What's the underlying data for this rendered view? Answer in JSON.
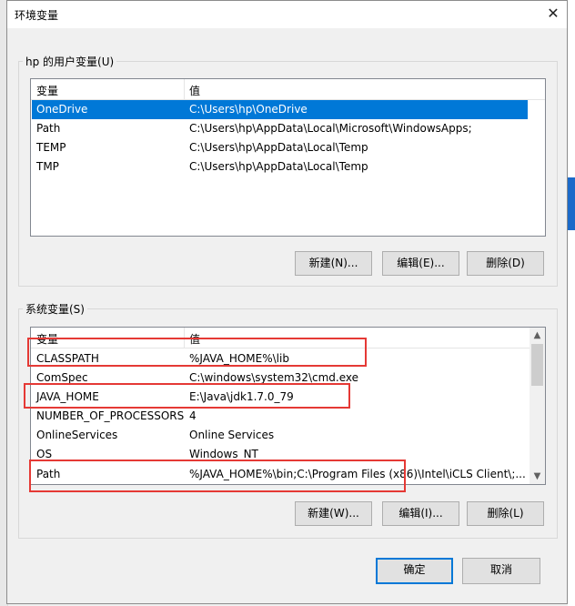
{
  "window": {
    "title": "环境变量",
    "close_glyph": "✕"
  },
  "user_vars": {
    "group_label": "hp 的用户变量(U)",
    "columns": [
      "变量",
      "值"
    ],
    "rows": [
      {
        "name": "OneDrive",
        "value": "C:\\Users\\hp\\OneDrive"
      },
      {
        "name": "Path",
        "value": "C:\\Users\\hp\\AppData\\Local\\Microsoft\\WindowsApps;"
      },
      {
        "name": "TEMP",
        "value": "C:\\Users\\hp\\AppData\\Local\\Temp"
      },
      {
        "name": "TMP",
        "value": "C:\\Users\\hp\\AppData\\Local\\Temp"
      }
    ],
    "buttons": {
      "new": "新建(N)...",
      "edit": "编辑(E)...",
      "delete": "删除(D)"
    }
  },
  "system_vars": {
    "group_label": "系统变量(S)",
    "columns": [
      "变量",
      "值"
    ],
    "rows": [
      {
        "name": "CLASSPATH",
        "value": "%JAVA_HOME%\\lib"
      },
      {
        "name": "ComSpec",
        "value": "C:\\windows\\system32\\cmd.exe"
      },
      {
        "name": "JAVA_HOME",
        "value": "E:\\Java\\jdk1.7.0_79"
      },
      {
        "name": "NUMBER_OF_PROCESSORS",
        "value": "4"
      },
      {
        "name": "OnlineServices",
        "value": "Online Services"
      },
      {
        "name": "OS",
        "value": "Windows_NT"
      },
      {
        "name": "Path",
        "value": "%JAVA_HOME%\\bin;C:\\Program Files (x86)\\Intel\\iCLS Client\\;..."
      }
    ],
    "buttons": {
      "new": "新建(W)...",
      "edit": "编辑(I)...",
      "delete": "删除(L)"
    }
  },
  "footer": {
    "ok": "确定",
    "cancel": "取消"
  },
  "colors": {
    "selection": "#0078d7",
    "highlight_box": "#e53935"
  },
  "selected_user_row": "OneDrive",
  "highlighted_system_rows": [
    "CLASSPATH",
    "JAVA_HOME",
    "Path"
  ]
}
